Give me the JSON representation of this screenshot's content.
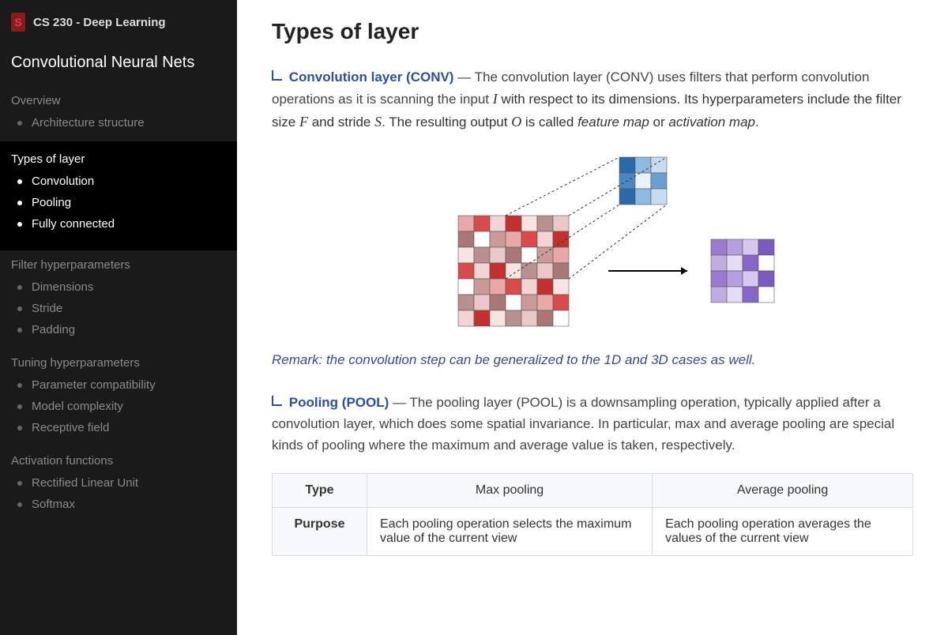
{
  "header": {
    "course": "CS 230 - Deep Learning",
    "subtitle": "Convolutional Neural Nets"
  },
  "sidebar": [
    {
      "title": "Overview",
      "active": false,
      "items": [
        {
          "label": "Architecture structure"
        }
      ]
    },
    {
      "title": "Types of layer",
      "active": true,
      "items": [
        {
          "label": "Convolution"
        },
        {
          "label": "Pooling"
        },
        {
          "label": "Fully connected"
        }
      ]
    },
    {
      "title": "Filter hyperparameters",
      "active": false,
      "items": [
        {
          "label": "Dimensions"
        },
        {
          "label": "Stride"
        },
        {
          "label": "Padding"
        }
      ]
    },
    {
      "title": "Tuning hyperparameters",
      "active": false,
      "items": [
        {
          "label": "Parameter compatibility"
        },
        {
          "label": "Model complexity"
        },
        {
          "label": "Receptive field"
        }
      ]
    },
    {
      "title": "Activation functions",
      "active": false,
      "items": [
        {
          "label": "Rectified Linear Unit"
        },
        {
          "label": "Softmax"
        }
      ]
    }
  ],
  "main": {
    "title": "Types of layer",
    "conv": {
      "heading": "Convolution layer (CONV)",
      "t1": " — The convolution layer (CONV) uses filters that perform convolution operations as it is scanning the input ",
      "v1": "I",
      "t2": " with respect to its dimensions. Its hyperparameters include the filter size ",
      "v2": "F",
      "t3": " and stride ",
      "v3": "S",
      "t4": ". The resulting output ",
      "v4": "O",
      "t5": " is called ",
      "em1": "feature map",
      "t6": " or ",
      "em2": "activation map",
      "t7": "."
    },
    "remark": "Remark: the convolution step can be generalized to the 1D and 3D cases as well.",
    "pool": {
      "heading": "Pooling (POOL)",
      "body": " — The pooling layer (POOL) is a downsampling operation, typically applied after a convolution layer, which does some spatial invariance. In particular, max and average pooling are special kinds of pooling where the maximum and average value is taken, respectively."
    },
    "table": {
      "h_type": "Type",
      "h_max": "Max pooling",
      "h_avg": "Average pooling",
      "r_purpose": "Purpose",
      "c_max": "Each pooling operation selects the maximum value of the current view",
      "c_avg": "Each pooling operation averages the values of the current view"
    }
  }
}
